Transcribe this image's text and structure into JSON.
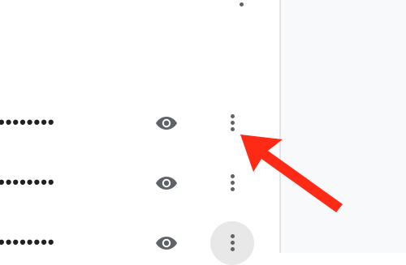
{
  "passwords": {
    "rows": [
      {
        "masked_value": "••••••••"
      },
      {
        "masked_value": "••••••••"
      },
      {
        "masked_value": "••••••••"
      }
    ]
  },
  "icons": {
    "show_password": "eye-icon",
    "more_actions": "more-vert-icon"
  },
  "colors": {
    "icon": "#5f6368",
    "text": "#202124",
    "annotation": "#ff2a16",
    "side_panel": "#f8f9fa"
  }
}
